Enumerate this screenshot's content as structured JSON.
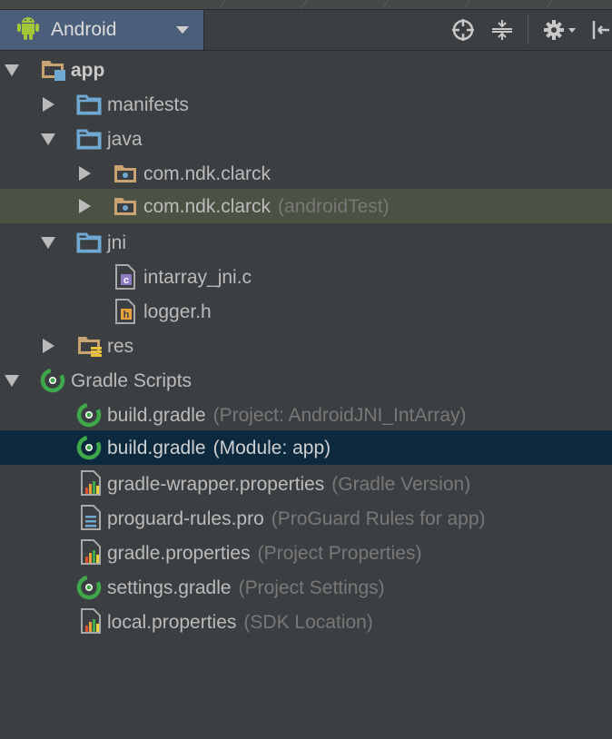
{
  "toolbar": {
    "view_label": "Android",
    "icons": [
      "target-icon",
      "collapse-icon",
      "gear-icon",
      "hide-panel-icon"
    ]
  },
  "tree": {
    "app": "app",
    "manifests": "manifests",
    "java": "java",
    "pkg1": "com.ndk.clarck",
    "pkg2": "com.ndk.clarck",
    "pkg2_hint": "(androidTest)",
    "jni": "jni",
    "file_c": "intarray_jni.c",
    "file_h": "logger.h",
    "res": "res",
    "gradle_scripts": "Gradle Scripts",
    "build_project": "build.gradle",
    "build_project_hint": "(Project: AndroidJNI_IntArray)",
    "build_module": "build.gradle",
    "build_module_hint": "(Module: app)",
    "wrapper": "gradle-wrapper.properties",
    "wrapper_hint": "(Gradle Version)",
    "proguard": "proguard-rules.pro",
    "proguard_hint": "(ProGuard Rules for app)",
    "gradle_props": "gradle.properties",
    "gradle_props_hint": "(Project Properties)",
    "settings": "settings.gradle",
    "settings_hint": "(Project Settings)",
    "local_props": "local.properties",
    "local_props_hint": "(SDK Location)"
  },
  "colors": {
    "background": "#3c3f41",
    "selected_row": "#0d293e",
    "highlighted_row": "#4b5244",
    "folder_blue": "#6fa8d3",
    "package_tan": "#c9a472",
    "gradle_green": "#3ea84a",
    "hint_gray": "#787878"
  }
}
